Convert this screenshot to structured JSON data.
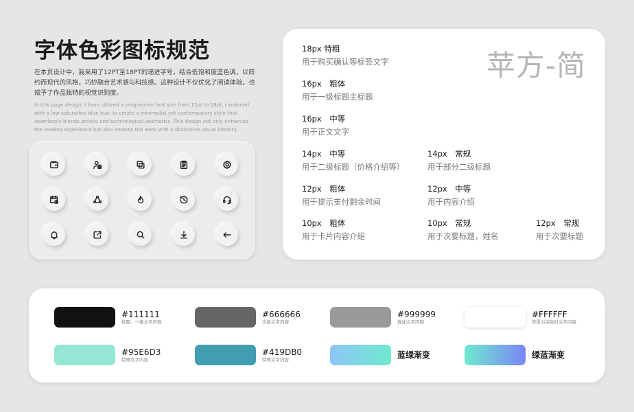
{
  "header": {
    "title": "字体色彩图标规范",
    "desc_cn": "在本页设计中，我采用了12PT至18PT的递进字号，结合低饱和度蓝色调，以简约而现代的风格，巧妙融合艺术感与科技感。这种设计不仅优化了阅读体验，也赋予了作品独特的视觉识别度。",
    "desc_en": "In this page design, I have utilized a progressive font size from 12pt to 18pt, combined with a low-saturation blue hue, to create a minimalist yet contemporary style that seamlessly blends artistic and technological aesthetics. This design not only enhances the reading experience but also endows the work with a distinctive visual identity."
  },
  "icons": [
    "wallet-icon",
    "user-document-icon",
    "copy-icon",
    "clipboard-icon",
    "settings-icon",
    "calendar-clock-icon",
    "recycle-icon",
    "flame-icon",
    "history-icon",
    "headset-icon",
    "bell-icon",
    "share-icon",
    "search-icon",
    "download-icon",
    "arrow-left-icon"
  ],
  "typography": {
    "font_name": "苹方-简",
    "items": [
      {
        "spec": "18px 特粗",
        "usage": "用于购买确认等标签文字"
      },
      {
        "spec": "16px　粗体",
        "usage": "用于一级标题主标题"
      },
      {
        "spec": "16px　中等",
        "usage": "用于正文文字"
      },
      {
        "spec": "14px　中等",
        "usage": "用于二级标题（价格介绍等）"
      },
      {
        "spec": "14px　常规",
        "usage": "用于部分二级标题"
      },
      {
        "spec": "12px　粗体",
        "usage": "用于提示支付剩余时间"
      },
      {
        "spec": "12px　中等",
        "usage": "用于内容介绍"
      },
      {
        "spec": "10px　粗体",
        "usage": "用于卡片内容介绍"
      },
      {
        "spec": "10px　常规",
        "usage": "用于次要标题，姓名"
      },
      {
        "spec": "12px　常规",
        "usage": "用于次要标题"
      }
    ]
  },
  "colors": [
    {
      "label": "#111111",
      "note": "标题，一级文字内容",
      "color": "#111111"
    },
    {
      "label": "#666666",
      "note": "次级文字内容",
      "color": "#666666"
    },
    {
      "label": "#999999",
      "note": "描述文字内容",
      "color": "#999999"
    },
    {
      "label": "#FFFFFF",
      "note": "背景为深色时文字内容",
      "color": "#FFFFFF"
    },
    {
      "label": "#95E6D3",
      "note": "特殊文字内容",
      "color": "#95E6D3"
    },
    {
      "label": "#419DB0",
      "note": "特殊文字内容",
      "color": "#419DB0"
    },
    {
      "label": "蓝绿渐变",
      "note": "",
      "gradient": [
        "#8ec5f7",
        "#6fe9cf"
      ]
    },
    {
      "label": "绿蓝渐变",
      "note": "",
      "gradient": [
        "#6fe9cf",
        "#7a86f5"
      ]
    }
  ]
}
